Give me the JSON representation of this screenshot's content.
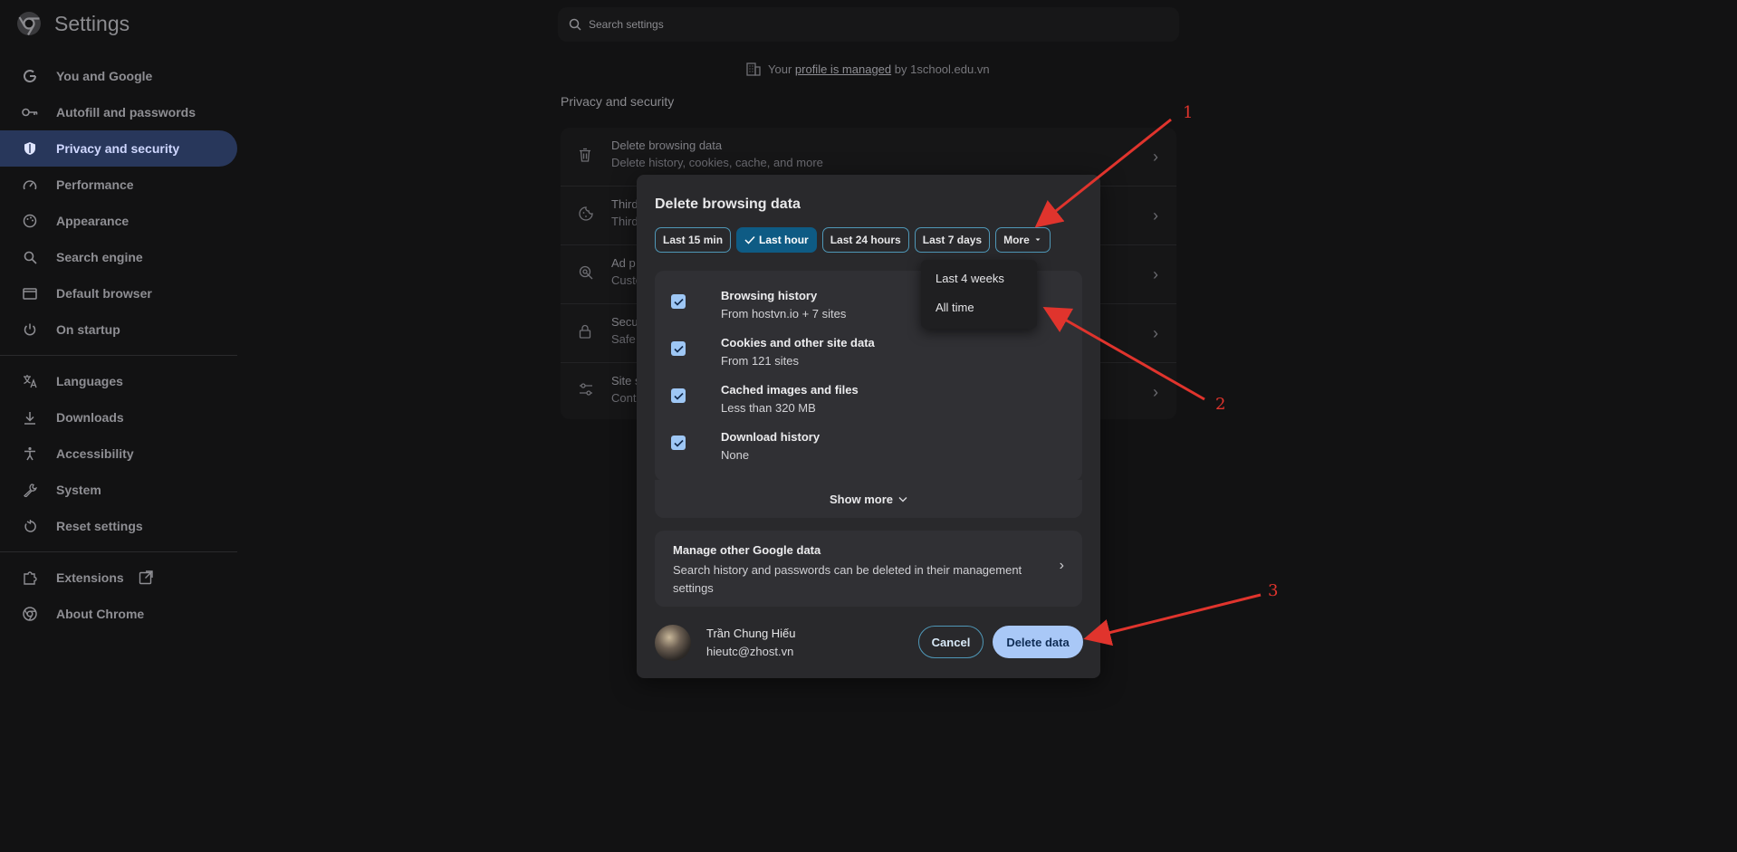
{
  "app": {
    "title": "Settings"
  },
  "search": {
    "placeholder": "Search settings"
  },
  "sidebar": {
    "items": [
      {
        "label": "You and Google",
        "icon": "google-icon"
      },
      {
        "label": "Autofill and passwords",
        "icon": "key-icon"
      },
      {
        "label": "Privacy and security",
        "icon": "shield-icon",
        "active": true
      },
      {
        "label": "Performance",
        "icon": "speedometer-icon"
      },
      {
        "label": "Appearance",
        "icon": "palette-icon"
      },
      {
        "label": "Search engine",
        "icon": "search-icon"
      },
      {
        "label": "Default browser",
        "icon": "browser-window-icon"
      },
      {
        "label": "On startup",
        "icon": "power-icon"
      },
      {
        "label": "Languages",
        "icon": "translate-icon"
      },
      {
        "label": "Downloads",
        "icon": "download-icon"
      },
      {
        "label": "Accessibility",
        "icon": "accessibility-icon"
      },
      {
        "label": "System",
        "icon": "wrench-icon"
      },
      {
        "label": "Reset settings",
        "icon": "reset-icon"
      },
      {
        "label": "Extensions",
        "icon": "puzzle-icon"
      },
      {
        "label": "About Chrome",
        "icon": "chrome-icon"
      }
    ]
  },
  "managed": {
    "prefix": "Your",
    "link": "profile is managed",
    "suffix": "by 1school.edu.vn"
  },
  "main": {
    "section_title": "Privacy and security",
    "rows": [
      {
        "title": "Delete browsing data",
        "subtitle": "Delete history, cookies, cache, and more",
        "icon": "trash-icon"
      },
      {
        "title": "Third",
        "subtitle": "Third",
        "icon": "cookie-icon"
      },
      {
        "title": "Ad p",
        "subtitle": "Custo",
        "icon": "ad-privacy-icon"
      },
      {
        "title": "Secu",
        "subtitle": "Safe",
        "icon": "lock-icon"
      },
      {
        "title": "Site s",
        "subtitle": "Cont",
        "icon": "sliders-icon"
      }
    ]
  },
  "dialog": {
    "title": "Delete browsing data",
    "time_ranges": [
      "Last 15 min",
      "Last hour",
      "Last 24 hours",
      "Last 7 days",
      "More"
    ],
    "selected_range": "Last hour",
    "items": [
      {
        "title": "Browsing history",
        "detail": "From hostvn.io + 7 sites",
        "checked": true
      },
      {
        "title": "Cookies and other site data",
        "detail": "From 121 sites",
        "checked": true
      },
      {
        "title": "Cached images and files",
        "detail": "Less than 320 MB",
        "checked": true
      },
      {
        "title": "Download history",
        "detail": "None",
        "checked": true
      }
    ],
    "show_more": "Show more",
    "manage": {
      "title": "Manage other Google data",
      "description": "Search history and passwords can be deleted in their management settings"
    },
    "user": {
      "name": "Trần Chung Hiếu",
      "email": "hieutc@zhost.vn"
    },
    "cancel_label": "Cancel",
    "delete_label": "Delete data"
  },
  "dropdown": {
    "options": [
      "Last 4 weeks",
      "All time"
    ]
  },
  "annotations": {
    "labels": [
      "1",
      "2",
      "3"
    ],
    "color": "#e0342d"
  },
  "colors": {
    "accent": "#a9c8f7",
    "chip_selected": "#0e5b84",
    "chip_border": "#4f97b7",
    "sidebar_active": "#28375b"
  }
}
